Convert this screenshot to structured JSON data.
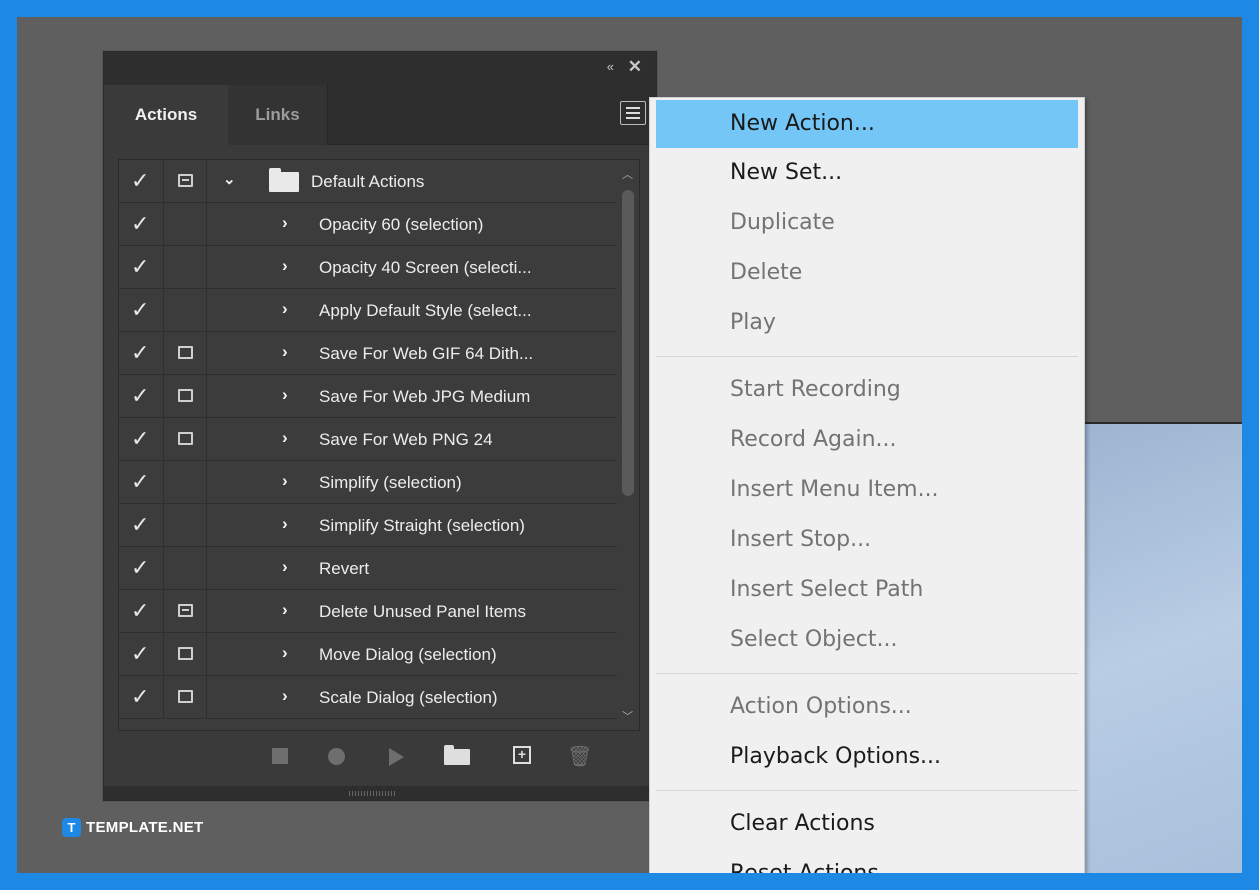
{
  "panel": {
    "tabs": [
      {
        "label": "Actions"
      },
      {
        "label": "Links"
      }
    ],
    "collapse_glyph": "«",
    "close_glyph": "✕",
    "set": {
      "name": "Default Actions"
    },
    "actions": [
      {
        "label": "Opacity 60 (selection)",
        "dialog": "none"
      },
      {
        "label": "Opacity 40 Screen (selecti...",
        "dialog": "none"
      },
      {
        "label": "Apply Default Style (select...",
        "dialog": "none"
      },
      {
        "label": "Save For Web GIF 64 Dith...",
        "dialog": "on"
      },
      {
        "label": "Save For Web JPG Medium",
        "dialog": "on"
      },
      {
        "label": "Save For Web PNG 24",
        "dialog": "on"
      },
      {
        "label": "Simplify (selection)",
        "dialog": "none"
      },
      {
        "label": "Simplify Straight (selection)",
        "dialog": "none"
      },
      {
        "label": "Revert",
        "dialog": "none"
      },
      {
        "label": "Delete Unused Panel Items",
        "dialog": "partial"
      },
      {
        "label": "Move Dialog (selection)",
        "dialog": "on"
      },
      {
        "label": "Scale Dialog (selection)",
        "dialog": "on"
      }
    ]
  },
  "logo": {
    "mark": "T",
    "text": "TEMPLATE.NET"
  },
  "menu": {
    "groups": [
      [
        {
          "label": "New Action...",
          "enabled": true,
          "highlighted": true
        },
        {
          "label": "New Set...",
          "enabled": true
        },
        {
          "label": "Duplicate",
          "enabled": false
        },
        {
          "label": "Delete",
          "enabled": false
        },
        {
          "label": "Play",
          "enabled": false
        }
      ],
      [
        {
          "label": "Start Recording",
          "enabled": false
        },
        {
          "label": "Record Again...",
          "enabled": false
        },
        {
          "label": "Insert Menu Item...",
          "enabled": false
        },
        {
          "label": "Insert Stop...",
          "enabled": false
        },
        {
          "label": "Insert Select Path",
          "enabled": false
        },
        {
          "label": "Select Object...",
          "enabled": false
        }
      ],
      [
        {
          "label": "Action Options...",
          "enabled": false
        },
        {
          "label": "Playback Options...",
          "enabled": true
        }
      ],
      [
        {
          "label": "Clear Actions",
          "enabled": true
        },
        {
          "label": "Reset Actions",
          "enabled": true
        }
      ]
    ]
  }
}
